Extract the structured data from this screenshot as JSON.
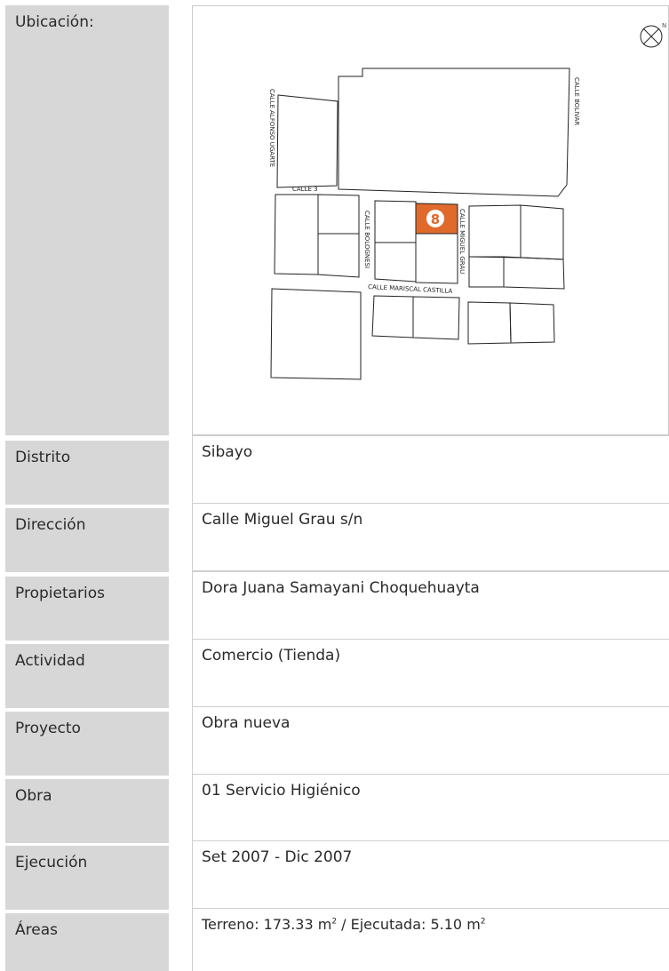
{
  "location": {
    "label": "Ubicación:",
    "map": {
      "marker": "8",
      "north": "N",
      "streets": {
        "alfonso_ugarte": "CALLE ALFONSO UGARTE",
        "bolivar": "CALLE BOLIVAR",
        "calle3": "CALLE 3",
        "bolognesi": "CALLE BOLOGNESI",
        "miguel_grau": "CALLE MIGUEL GRAU",
        "mariscal_castilla": "CALLE MARISCAL CASTILLA"
      },
      "marker_color": "#e06a2c"
    }
  },
  "rows": [
    {
      "label": "Distrito",
      "value": "Sibayo"
    },
    {
      "label": "Dirección",
      "value": "Calle Miguel Grau s/n"
    },
    {
      "label": "Propietarios",
      "value": "Dora Juana Samayani Choquehuayta"
    },
    {
      "label": "Actividad",
      "value": "Comercio (Tienda)"
    },
    {
      "label": "Proyecto",
      "value": "Obra nueva"
    },
    {
      "label": "Obra",
      "value": "01 Servicio Higiénico"
    },
    {
      "label": "Ejecución",
      "value": "Set 2007 - Dic 2007"
    }
  ],
  "areas": {
    "label": "Áreas",
    "terreno_prefix": "Terreno: 173.33 m",
    "ejecutada_prefix": " / Ejecutada: 5.10 m",
    "exponent": "2"
  }
}
